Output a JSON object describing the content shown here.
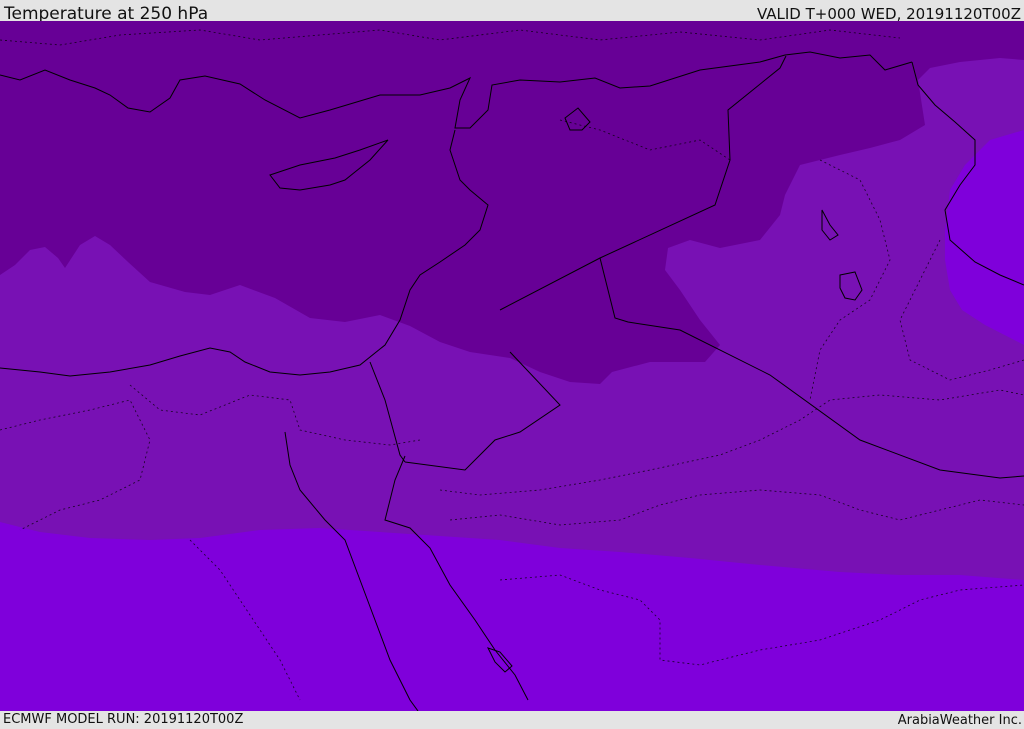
{
  "header": {
    "title": "Temperature at 250 hPa",
    "valid": "VALID T+000 WED, 20191120T00Z"
  },
  "footer": {
    "run": "ECMWF MODEL RUN: 20191120T00Z",
    "brand": "ArabiaWeather Inc."
  },
  "map": {
    "colors": {
      "cold_band": "#670096",
      "mid_band": "#7811b4",
      "warm_band": "#7f00db",
      "coastline": "#000000"
    }
  }
}
